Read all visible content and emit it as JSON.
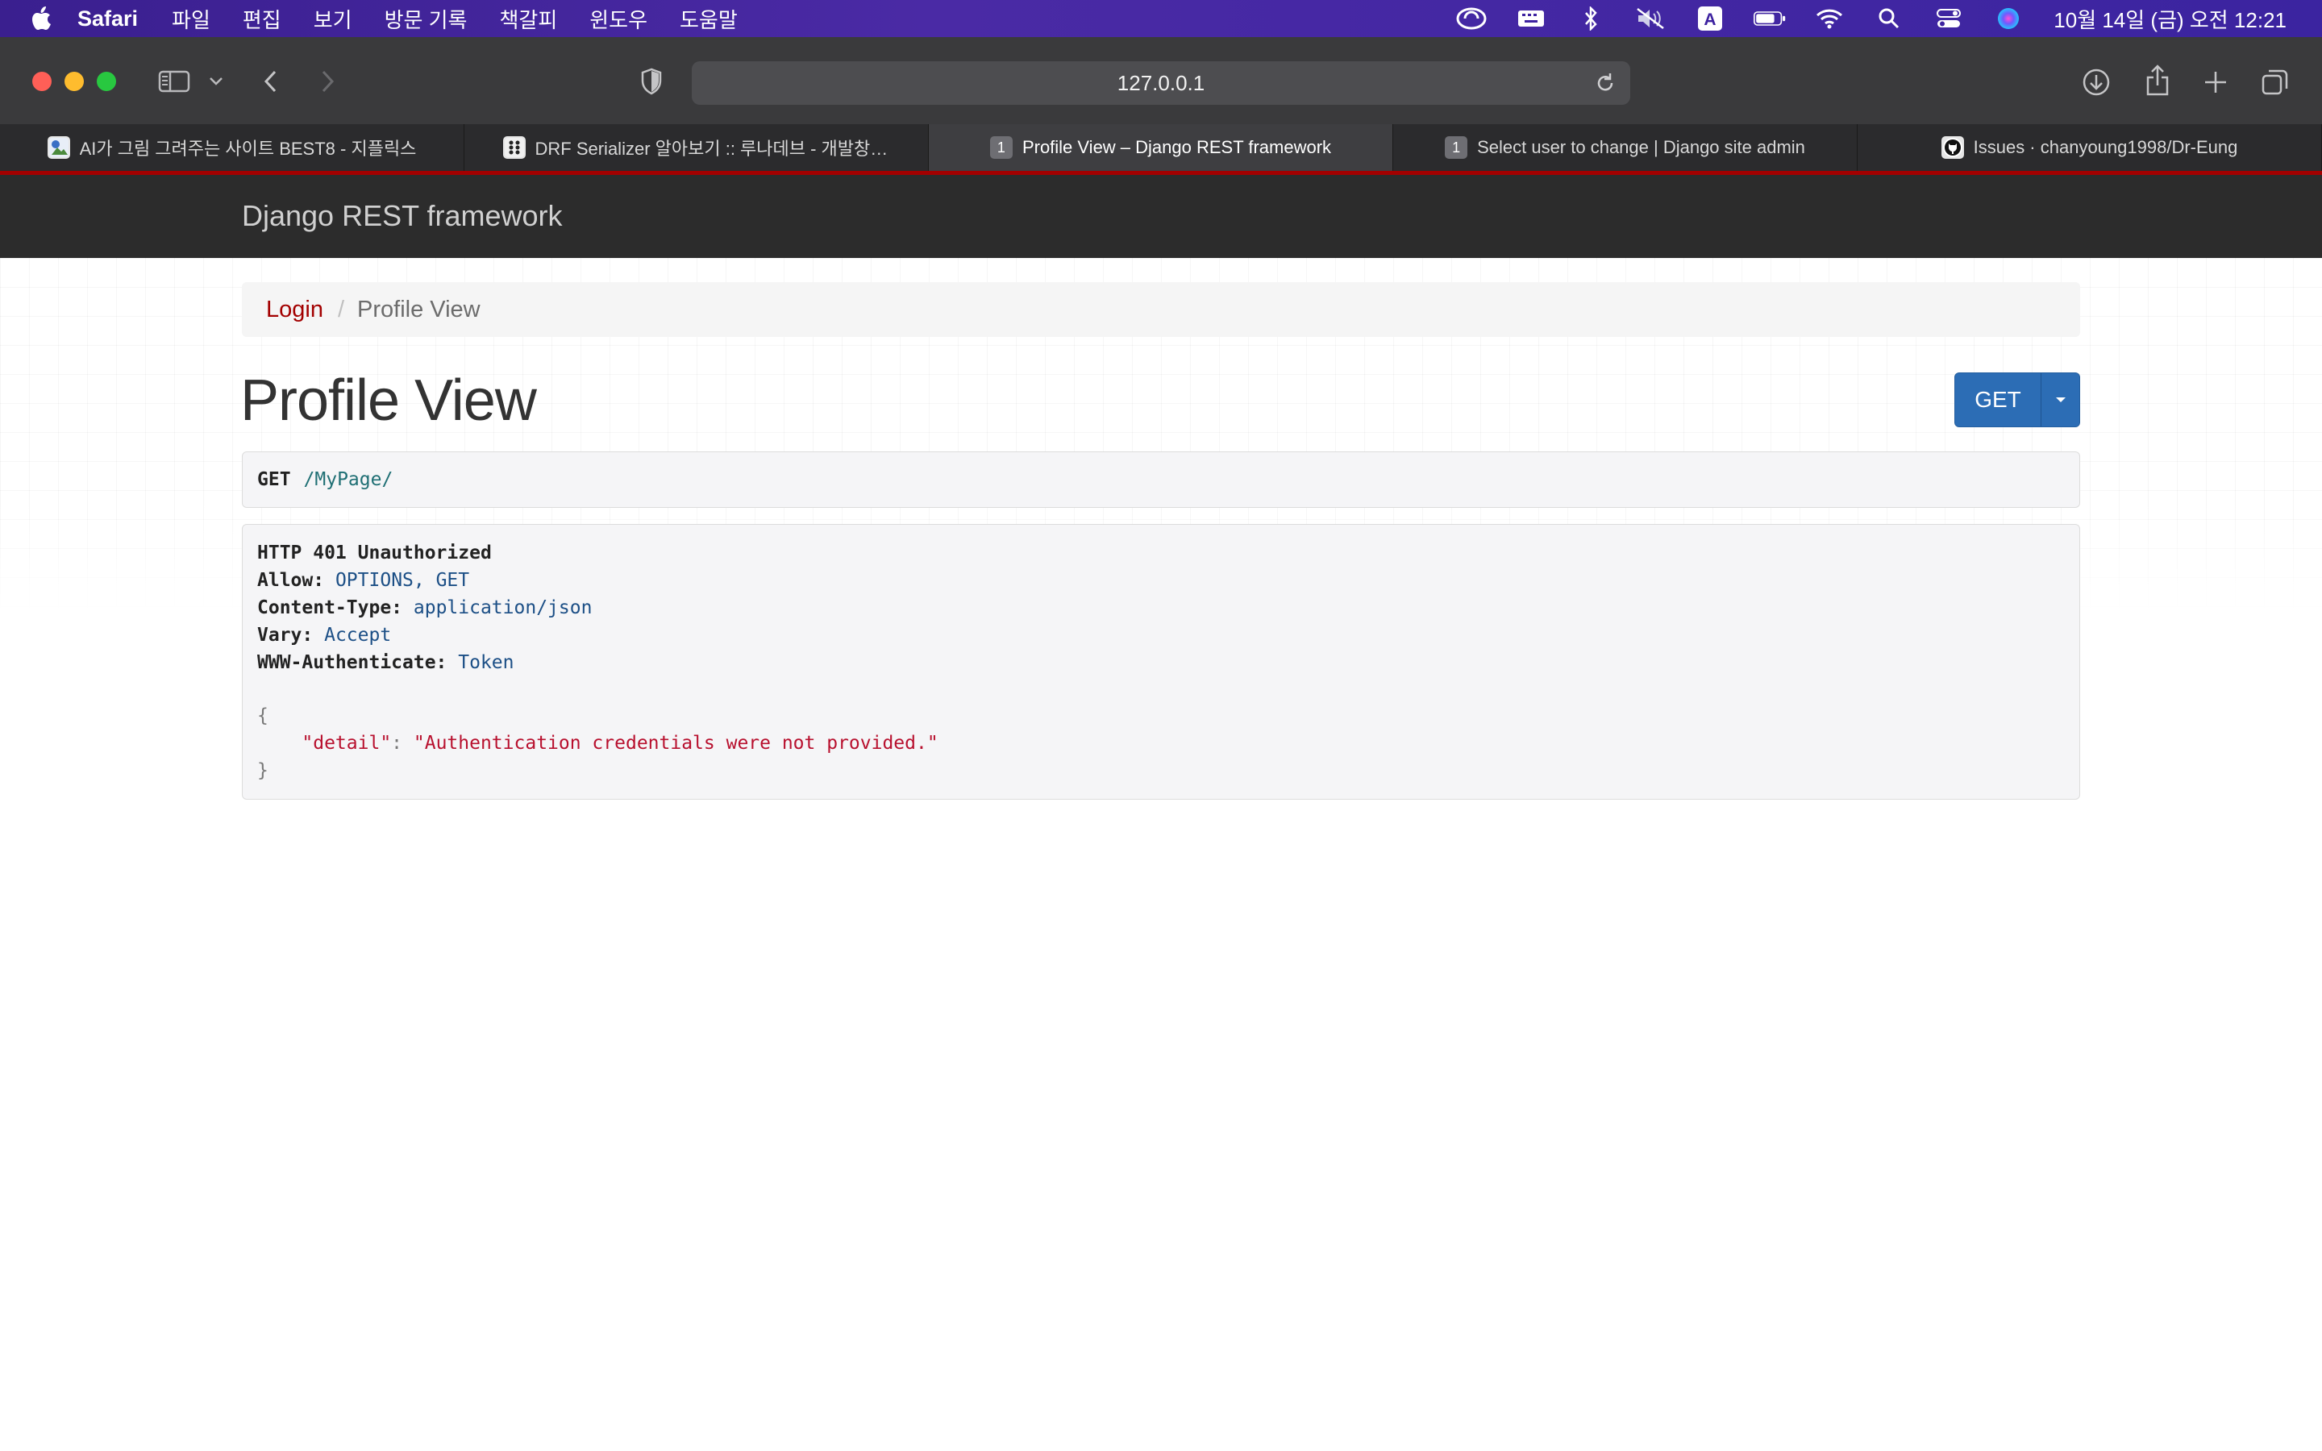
{
  "menubar": {
    "app_name": "Safari",
    "menus": [
      "파일",
      "편집",
      "보기",
      "방문 기록",
      "책갈피",
      "윈도우",
      "도움말"
    ],
    "icons": [
      "creative-cloud-icon",
      "keyboard-icon",
      "bluetooth-icon",
      "mute-icon",
      "input-source-icon",
      "battery-icon",
      "wifi-icon",
      "spotlight-icon",
      "control-center-icon",
      "siri-icon"
    ],
    "input_source": "A",
    "clock": "10월 14일 (금) 오전 12:21"
  },
  "toolbar": {
    "url": "127.0.0.1"
  },
  "tabs": [
    {
      "title": "AI가 그림 그려주는 사이트 BEST8 - 지플릭스",
      "favicon": "",
      "active": false
    },
    {
      "title": "DRF Serializer 알아보기 :: 루나데브 - 개발창업…",
      "favicon": "",
      "active": false
    },
    {
      "title": "Profile View – Django REST framework",
      "favicon": "1",
      "active": true
    },
    {
      "title": "Select user to change | Django site admin",
      "favicon": "1",
      "active": false
    },
    {
      "title": "Issues · chanyoung1998/Dr-Eung",
      "favicon": "",
      "active": false
    }
  ],
  "drf": {
    "brand": "Django REST framework",
    "breadcrumb": {
      "link": "Login",
      "separator": "/",
      "current": "Profile View"
    },
    "title": "Profile View",
    "get_button": "GET",
    "request": {
      "method": "GET",
      "path": "/MyPage/"
    },
    "response": {
      "status": "HTTP 401 Unauthorized",
      "headers": [
        {
          "key": "Allow:",
          "value": "OPTIONS, GET"
        },
        {
          "key": "Content-Type:",
          "value": "application/json"
        },
        {
          "key": "Vary:",
          "value": "Accept"
        },
        {
          "key": "WWW-Authenticate:",
          "value": "Token"
        }
      ],
      "body_open": "{",
      "body_key": "\"detail\"",
      "body_colon": ": ",
      "body_value": "\"Authentication credentials were not provided.\"",
      "body_close": "}"
    }
  },
  "colors": {
    "accent_red": "#a30000",
    "get_button": "#2c6db5",
    "navbar": "#2c2c2c"
  }
}
